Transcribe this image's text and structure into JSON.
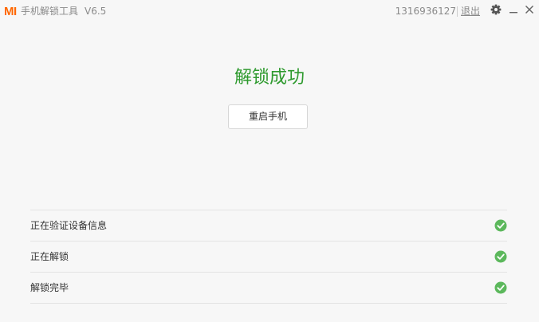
{
  "app": {
    "logo_text": "MI",
    "title": "手机解锁工具",
    "version": "V6.5",
    "account_id": "1316936127",
    "logout_label": "退出"
  },
  "icons": {
    "settings": "gear-icon",
    "minimize": "minimize-icon",
    "close": "close-icon",
    "step_status": "check-circle-icon"
  },
  "main": {
    "headline": "解锁成功",
    "restart_button": "重启手机"
  },
  "steps": [
    {
      "label": "正在验证设备信息",
      "status": "done"
    },
    {
      "label": "正在解锁",
      "status": "done"
    },
    {
      "label": "解锁完毕",
      "status": "done"
    }
  ],
  "colors": {
    "brand": "#ff6700",
    "success": "#2e9a2e",
    "check": "#5cb85c"
  }
}
